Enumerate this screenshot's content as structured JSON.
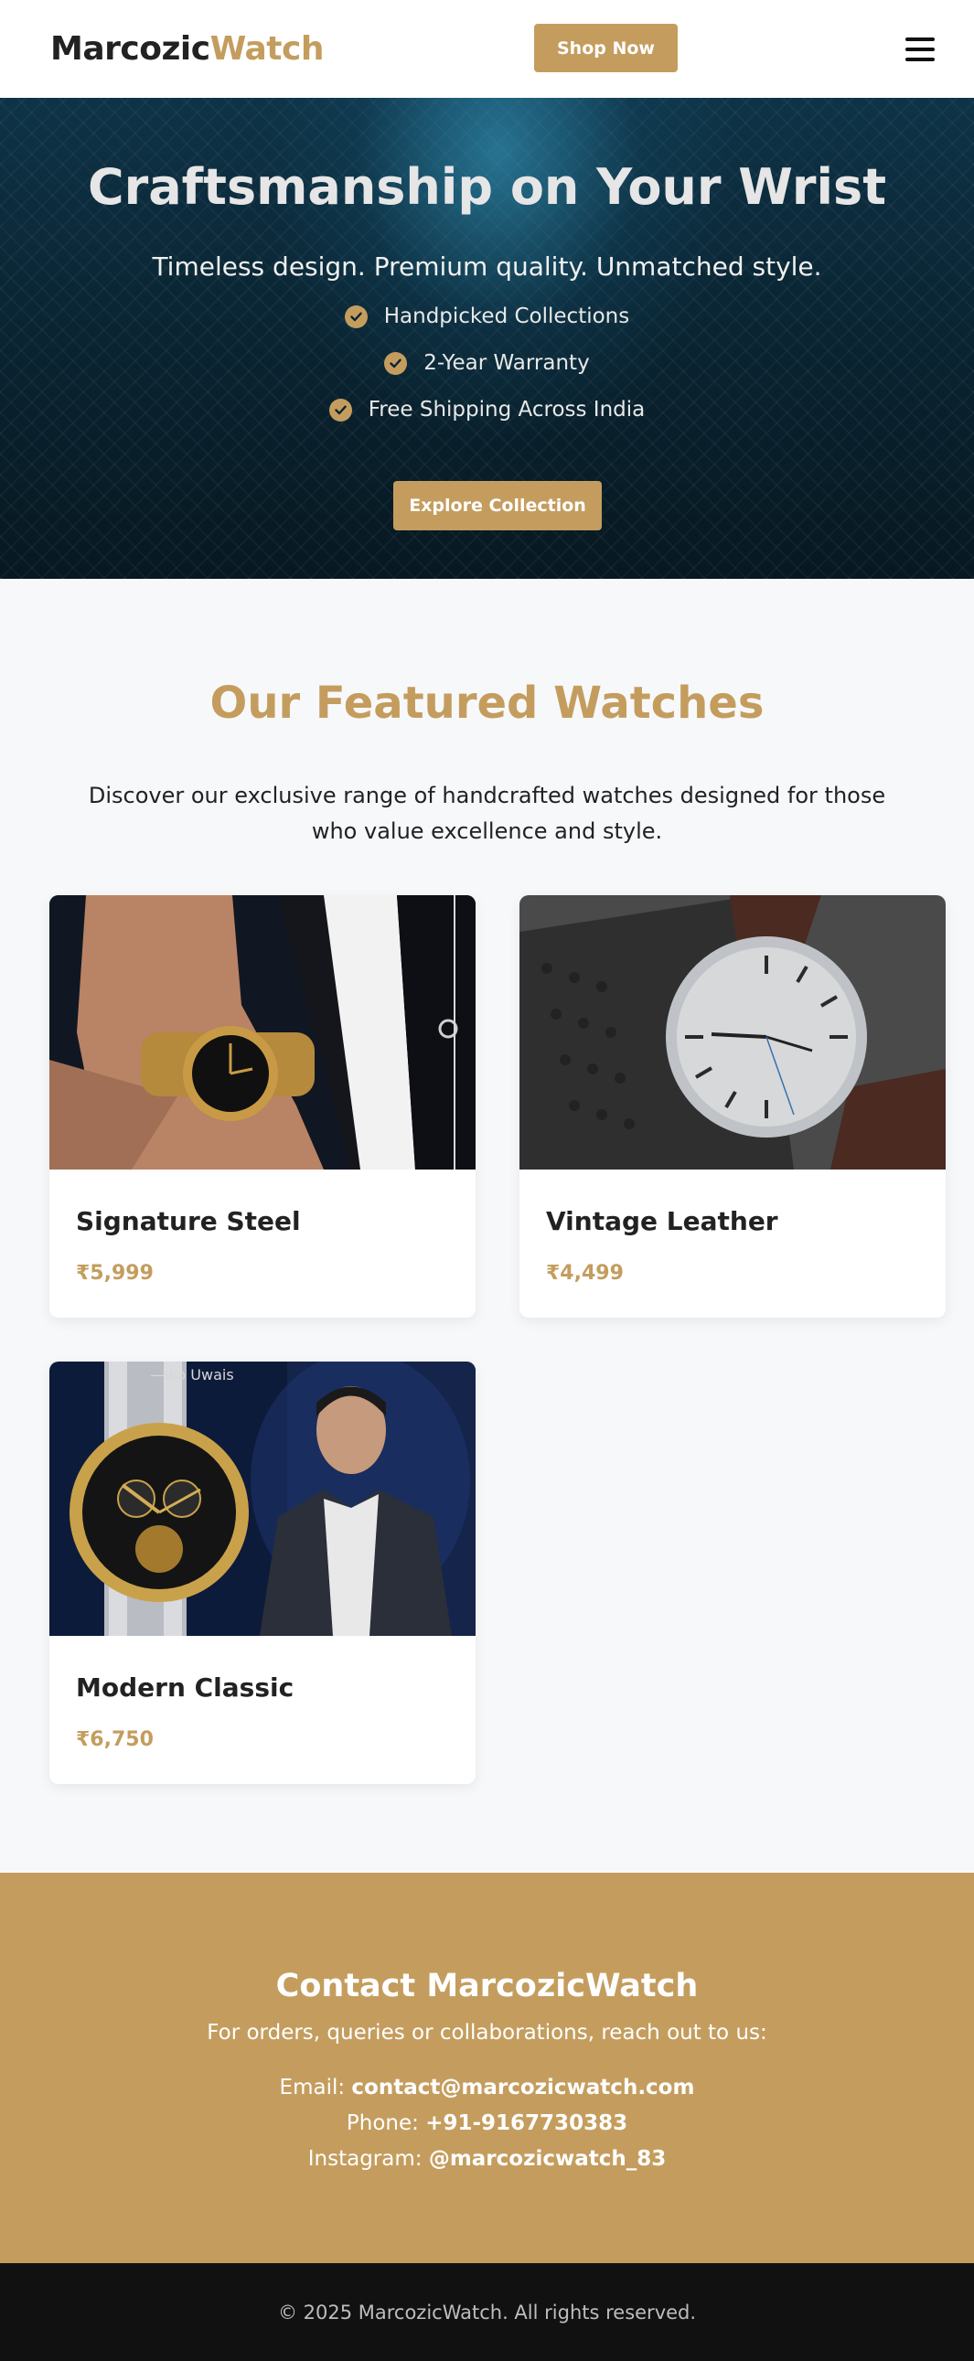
{
  "header": {
    "logo_part1": "Marcozic",
    "logo_part2": "Watch",
    "shop_button": "Shop Now",
    "menu_icon": "hamburger-menu-icon"
  },
  "hero": {
    "title": "Craftsmanship on Your Wrist",
    "subtitle": "Timeless design. Premium quality. Unmatched style.",
    "features": [
      {
        "icon": "check-circle-icon",
        "label": "Handpicked Collections"
      },
      {
        "icon": "check-circle-icon",
        "label": "2-Year Warranty"
      },
      {
        "icon": "check-circle-icon",
        "label": "Free Shipping Across India"
      }
    ],
    "cta": "Explore Collection"
  },
  "featured": {
    "title": "Our Featured Watches",
    "description": "Discover our exclusive range of handcrafted watches designed for those who value excellence and style.",
    "products": [
      {
        "name": "Signature Steel",
        "price": "₹5,999"
      },
      {
        "name": "Vintage Leather",
        "price": "₹4,499"
      },
      {
        "name": "Modern Classic",
        "price": "₹6,750"
      }
    ],
    "image_overlay_text": "—Iko Uwais"
  },
  "contact": {
    "title": "Contact MarcozicWatch",
    "subtitle": "For orders, queries or collaborations, reach out to us:",
    "email_label": "Email:",
    "email": "contact@marcozicwatch.com",
    "phone_label": "Phone:",
    "phone": "+91-9167730383",
    "instagram_label": "Instagram:",
    "instagram": "@marcozicwatch_83"
  },
  "footer": {
    "copyright": "© 2025 MarcozicWatch. All rights reserved."
  },
  "colors": {
    "accent": "#c49d5e",
    "dark": "#111111",
    "hero_bg": "#0a2533"
  }
}
